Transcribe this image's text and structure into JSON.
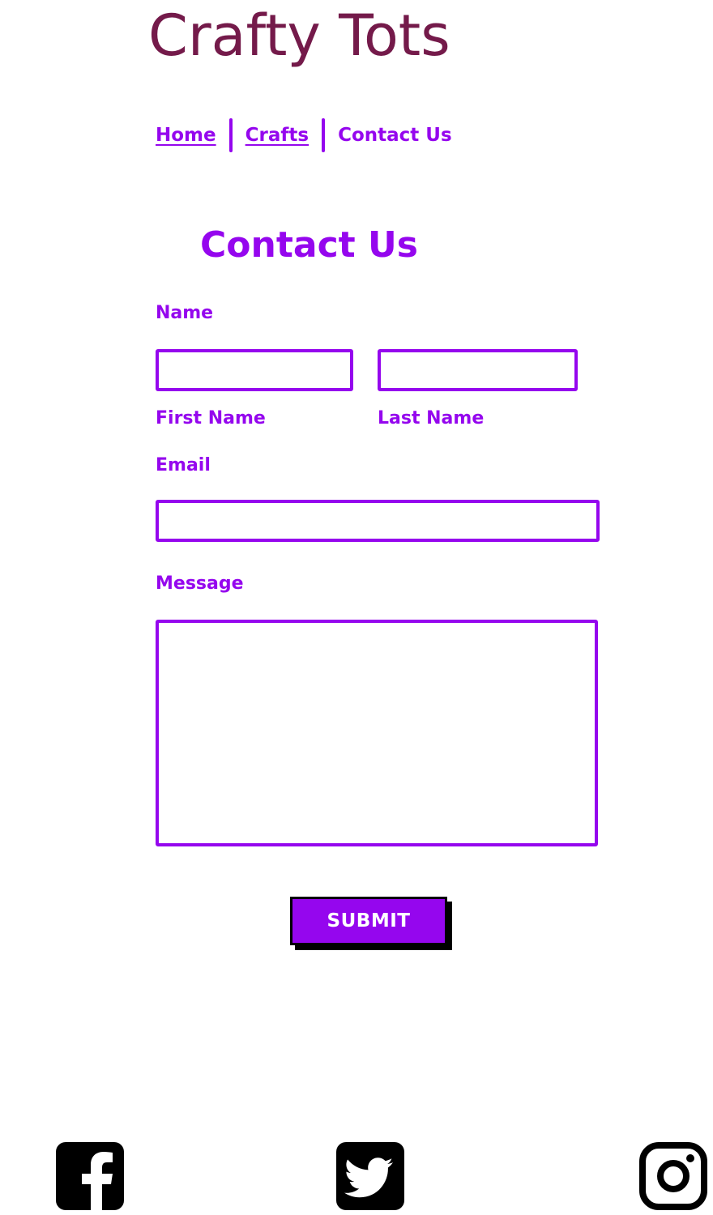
{
  "header": {
    "site_title": "Crafty Tots"
  },
  "nav": {
    "items": [
      {
        "label": "Home"
      },
      {
        "label": "Crafts"
      },
      {
        "label": "Contact Us"
      }
    ]
  },
  "main": {
    "heading": "Contact Us",
    "form": {
      "name_label": "Name",
      "first_name_label": "First Name",
      "last_name_label": "Last Name",
      "email_label": "Email",
      "message_label": "Message",
      "first_name_value": "",
      "last_name_value": "",
      "email_value": "",
      "message_value": "",
      "submit_label": "SUBMIT"
    }
  },
  "footer": {
    "social_icons": [
      "facebook-icon",
      "twitter-icon",
      "instagram-icon"
    ]
  },
  "colors": {
    "title": "#741a4a",
    "accent": "#9506ee",
    "button_text": "#ffffff",
    "button_shadow": "#000000"
  }
}
